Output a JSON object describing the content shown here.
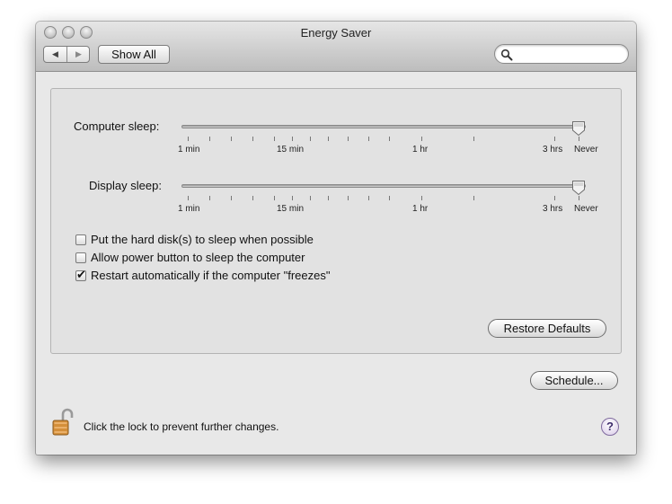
{
  "window": {
    "title": "Energy Saver"
  },
  "toolbar": {
    "back_glyph": "◀",
    "forward_glyph": "▶",
    "show_all_label": "Show All",
    "search_placeholder": ""
  },
  "computer_sleep": {
    "label": "Computer sleep:",
    "ticks": [
      "1 min",
      "15 min",
      "1 hr",
      "3 hrs",
      "Never"
    ],
    "value": "Never"
  },
  "display_sleep": {
    "label": "Display sleep:",
    "ticks": [
      "1 min",
      "15 min",
      "1 hr",
      "3 hrs",
      "Never"
    ],
    "value": "Never"
  },
  "options": [
    {
      "label": "Put the hard disk(s) to sleep when possible",
      "checked": false
    },
    {
      "label": "Allow power button to sleep the computer",
      "checked": false
    },
    {
      "label": "Restart automatically if the computer \"freezes\"",
      "checked": true
    }
  ],
  "buttons": {
    "restore_defaults": "Restore Defaults",
    "schedule": "Schedule..."
  },
  "footer": {
    "lock_text": "Click the lock to prevent further changes.",
    "help_glyph": "?"
  },
  "icons": {
    "lock": "unlocked-padlock-icon",
    "search": "magnifier-icon",
    "help": "help-icon"
  }
}
